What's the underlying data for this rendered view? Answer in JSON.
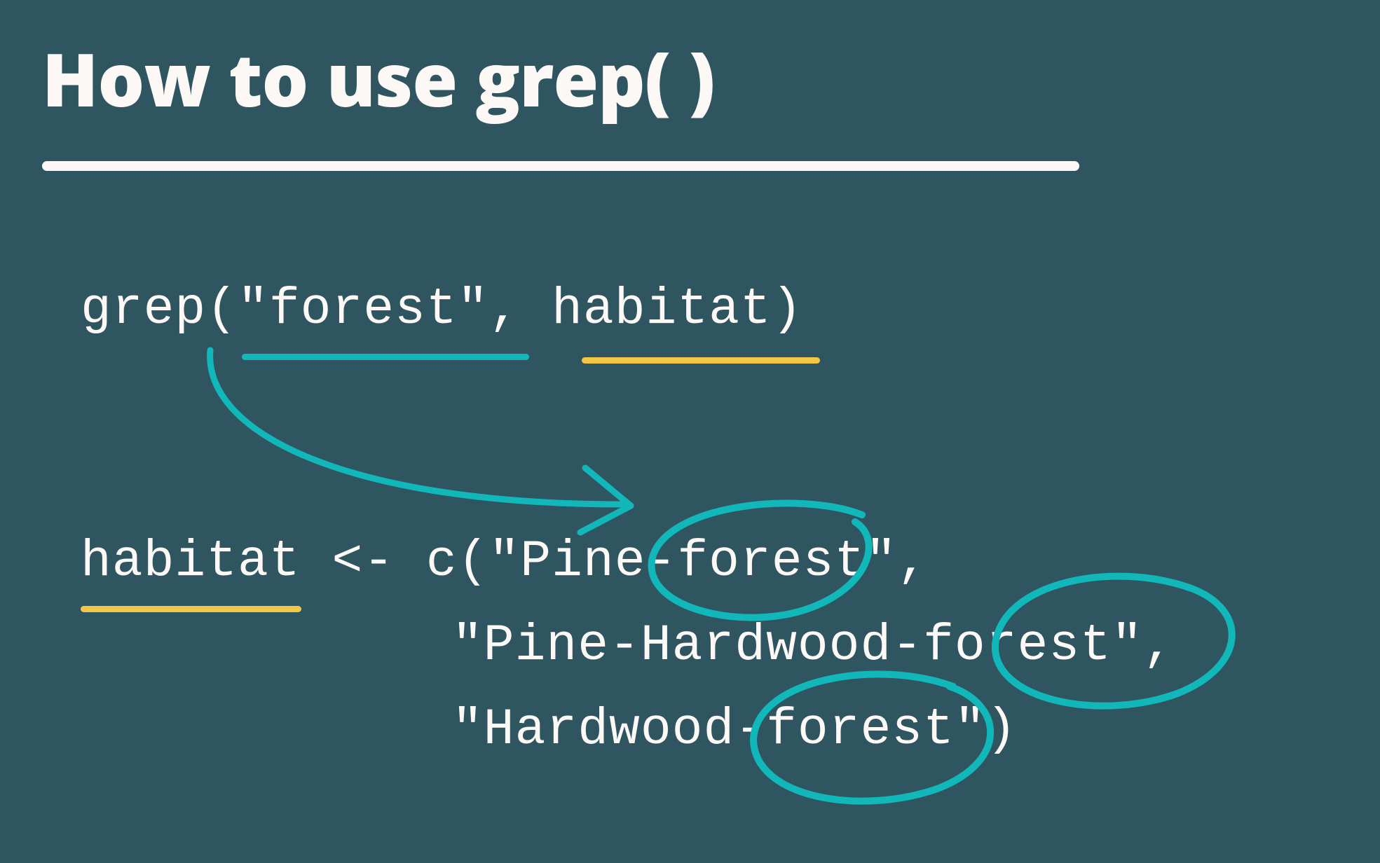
{
  "title": "How to use grep( )",
  "code": {
    "line1": "grep(\"forest\", habitat)",
    "line2": "habitat <- c(\"Pine-forest\",",
    "line3": "\"Pine-Hardwood-forest\",",
    "line4": "\"Hardwood-forest\")"
  },
  "colors": {
    "background": "#2e5560",
    "text": "#fbf8f5",
    "teal": "#12b7ba",
    "yellow": "#f4c845"
  },
  "annotations": {
    "underline_forest": "teal",
    "underline_habitat_arg": "yellow",
    "underline_habitat_var": "yellow",
    "arrow_forest_to_matches": "teal",
    "circles_forest_matches": "teal"
  }
}
